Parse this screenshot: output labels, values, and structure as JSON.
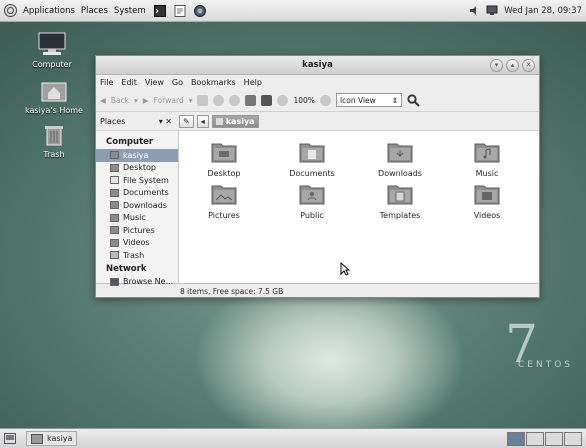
{
  "top_panel": {
    "menus": [
      "Applications",
      "Places",
      "System"
    ],
    "clock": "Wed Jan 28, 09:37"
  },
  "desktop": {
    "icons": [
      {
        "label": "Computer",
        "icon": "computer-icon"
      },
      {
        "label": "kasiya's Home",
        "icon": "home-folder-icon"
      },
      {
        "label": "Trash",
        "icon": "trash-icon"
      }
    ],
    "brand_numeral": "7",
    "brand_word": "CENTOS"
  },
  "window": {
    "title": "kasiya",
    "menu": [
      "File",
      "Edit",
      "View",
      "Go",
      "Bookmarks",
      "Help"
    ],
    "toolbar": {
      "back": "Back",
      "forward": "Forward",
      "zoom": "100%",
      "view_mode": "Icon View"
    },
    "location": {
      "places_label": "Places",
      "path_current": "kasiya"
    },
    "sidebar": {
      "computer_header": "Computer",
      "computer_items": [
        "kasiya",
        "Desktop",
        "File System",
        "Documents",
        "Downloads",
        "Music",
        "Pictures",
        "Videos",
        "Trash"
      ],
      "network_header": "Network",
      "network_items": [
        "Browse Ne..."
      ]
    },
    "folders": [
      "Desktop",
      "Documents",
      "Downloads",
      "Music",
      "Pictures",
      "Public",
      "Templates",
      "Videos"
    ],
    "status": "8 items, Free space: 7.5 GB"
  },
  "bottom_panel": {
    "task_label": "kasiya"
  },
  "colors": {
    "selection": "#8e9eb2",
    "folder": "#9a9a9a"
  }
}
